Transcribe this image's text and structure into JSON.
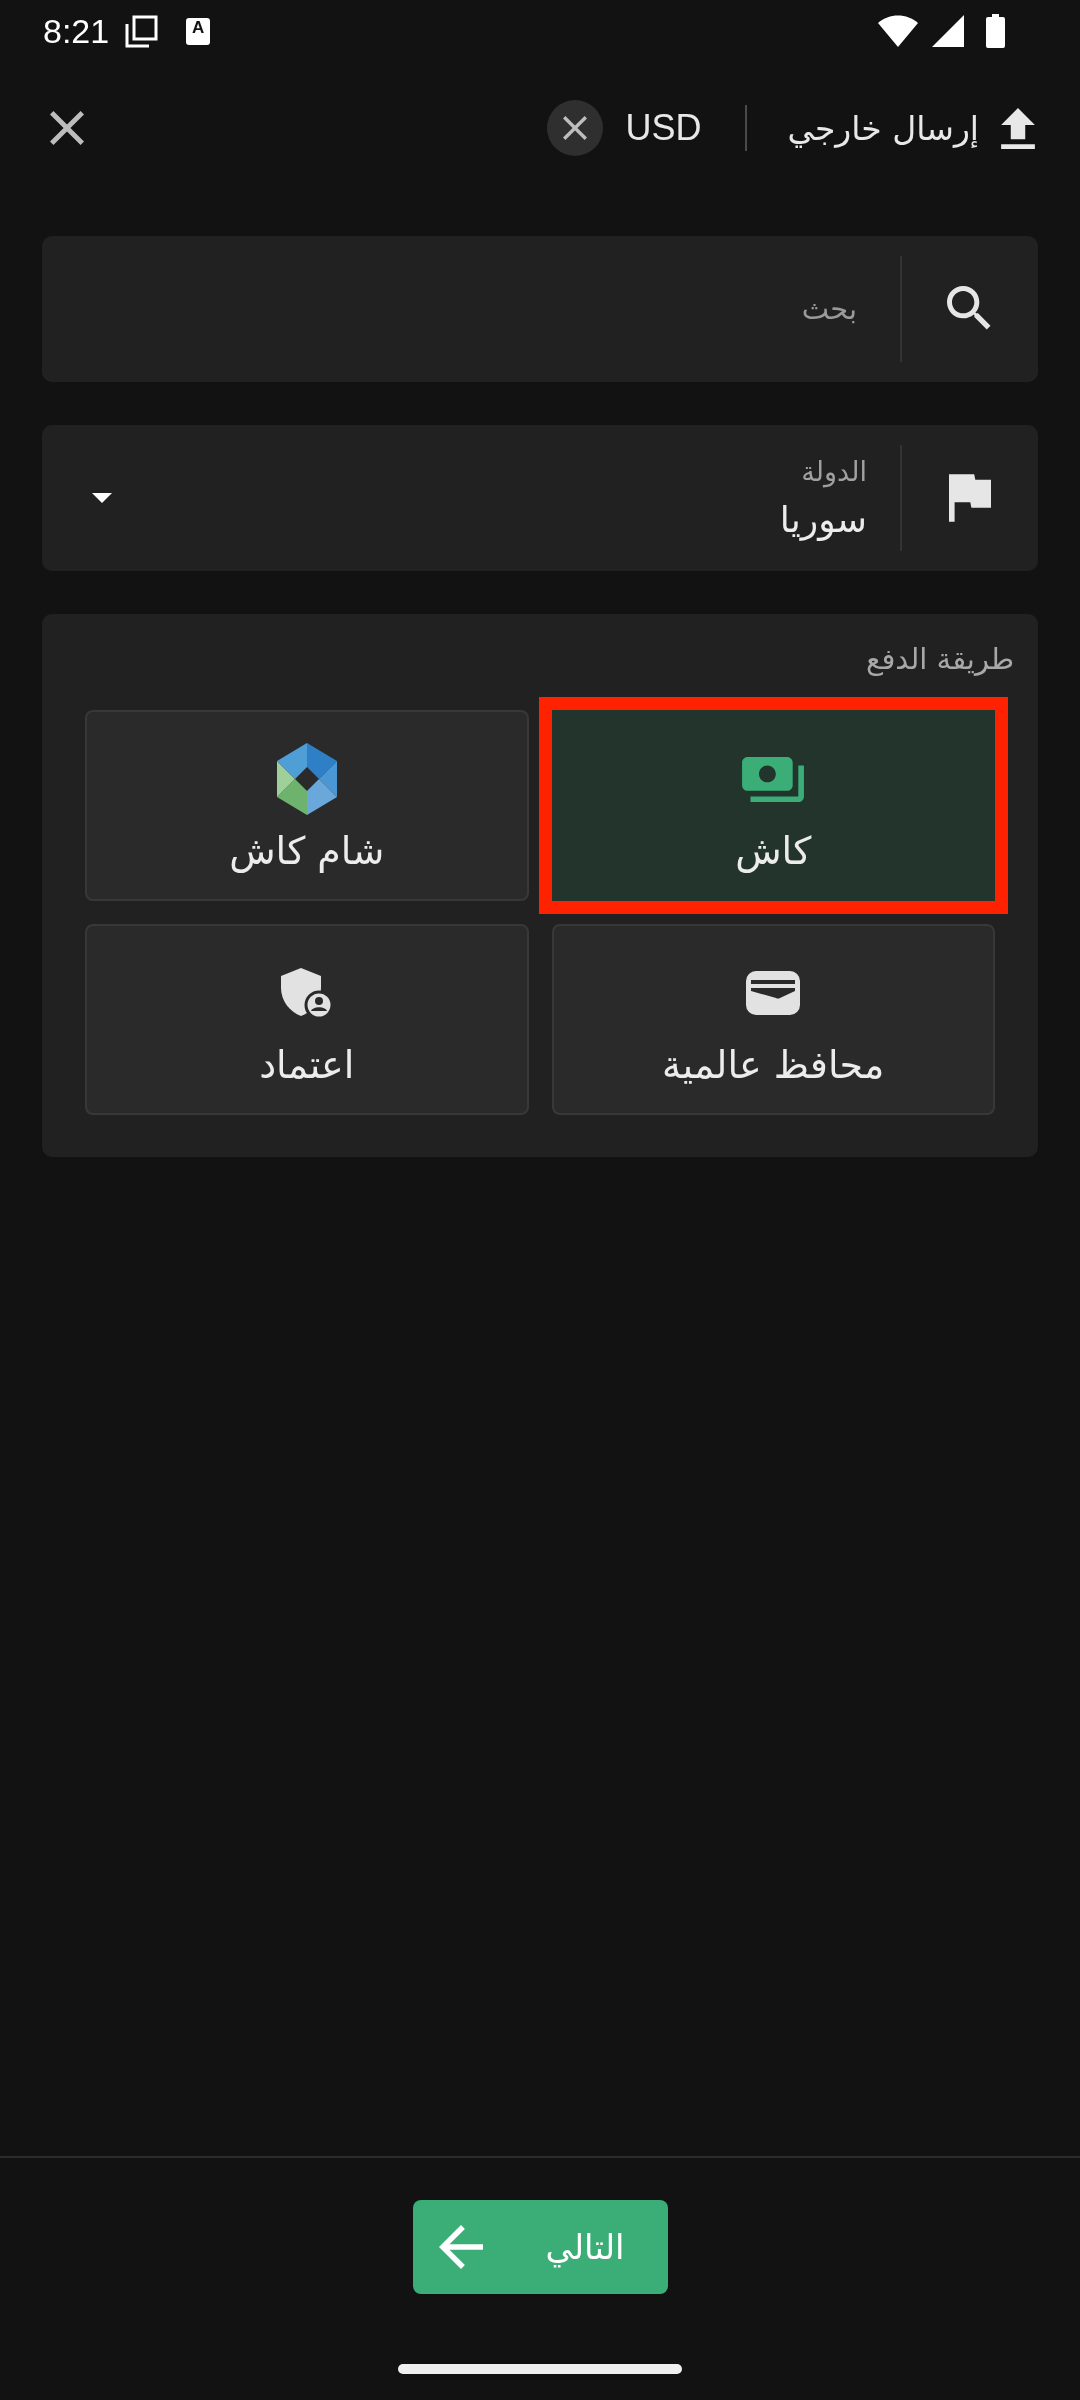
{
  "status_bar": {
    "time": "8:21",
    "notification_letter": "A"
  },
  "header": {
    "title": "إرسال خارجي",
    "currency": "USD"
  },
  "search": {
    "placeholder": "بحث"
  },
  "country": {
    "label": "الدولة",
    "value": "سوريا"
  },
  "payment_method": {
    "title": "طريقة الدفع",
    "options": [
      {
        "label": "كاش",
        "kind": "cash",
        "selected": true
      },
      {
        "label": "شام كاش",
        "kind": "sham_cash",
        "selected": false
      },
      {
        "label": "محافظ عالمية",
        "kind": "wallet",
        "selected": false
      },
      {
        "label": "اعتماد",
        "kind": "accreditation",
        "selected": false
      }
    ]
  },
  "next_button": {
    "label": "التالي"
  }
}
